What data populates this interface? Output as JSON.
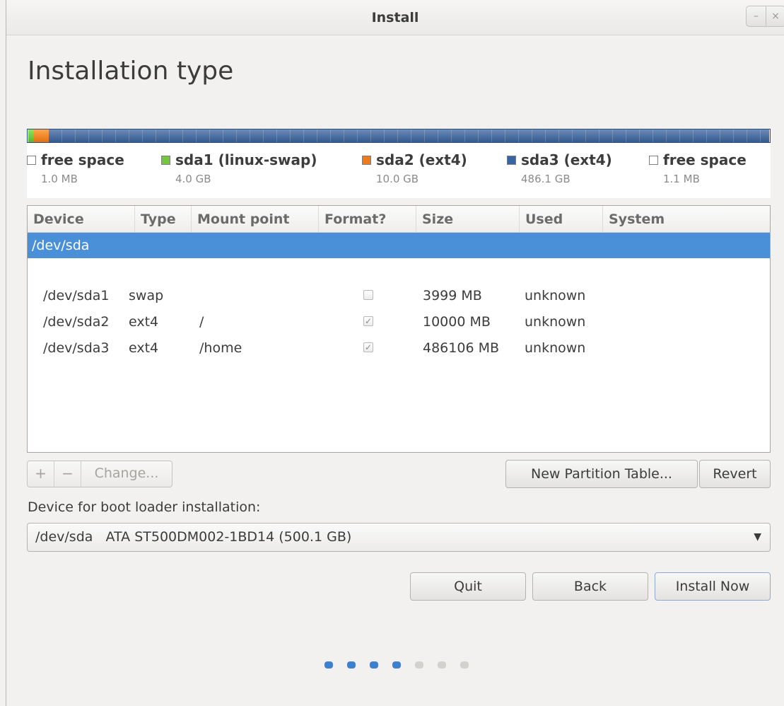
{
  "window": {
    "title": "Install",
    "minimize_label": "–",
    "close_label": "×"
  },
  "heading": "Installation type",
  "legend": [
    {
      "name": "free space",
      "size": "1.0 MB",
      "color": "#ffffff"
    },
    {
      "name": "sda1 (linux-swap)",
      "size": "4.0 GB",
      "color": "#73c73c"
    },
    {
      "name": "sda2 (ext4)",
      "size": "10.0 GB",
      "color": "#f07a1a"
    },
    {
      "name": "sda3 (ext4)",
      "size": "486.1 GB",
      "color": "#3a64a0"
    },
    {
      "name": "free space",
      "size": "1.1 MB",
      "color": "#ffffff"
    }
  ],
  "table": {
    "headers": [
      "Device",
      "Type",
      "Mount point",
      "Format?",
      "Size",
      "Used",
      "System"
    ],
    "disk_row": "/dev/sda",
    "partitions": [
      {
        "device": "/dev/sda1",
        "type": "swap",
        "mount": "",
        "format": false,
        "size": "3999 MB",
        "used": "unknown",
        "system": ""
      },
      {
        "device": "/dev/sda2",
        "type": "ext4",
        "mount": "/",
        "format": true,
        "size": "10000 MB",
        "used": "unknown",
        "system": ""
      },
      {
        "device": "/dev/sda3",
        "type": "ext4",
        "mount": "/home",
        "format": true,
        "size": "486106 MB",
        "used": "unknown",
        "system": ""
      }
    ]
  },
  "toolbar": {
    "add_label": "+",
    "remove_label": "−",
    "change_label": "Change..."
  },
  "buttons": {
    "new_partition_table": "New Partition Table...",
    "revert": "Revert",
    "quit": "Quit",
    "back": "Back",
    "install_now": "Install Now"
  },
  "bootloader": {
    "label": "Device for boot loader installation:",
    "selected": "/dev/sda   ATA ST500DM002-1BD14 (500.1 GB)"
  },
  "progress": {
    "total_steps": 7,
    "completed_steps": 4,
    "active_color": "#3d7fd0",
    "inactive_color": "#d3d1cd"
  }
}
